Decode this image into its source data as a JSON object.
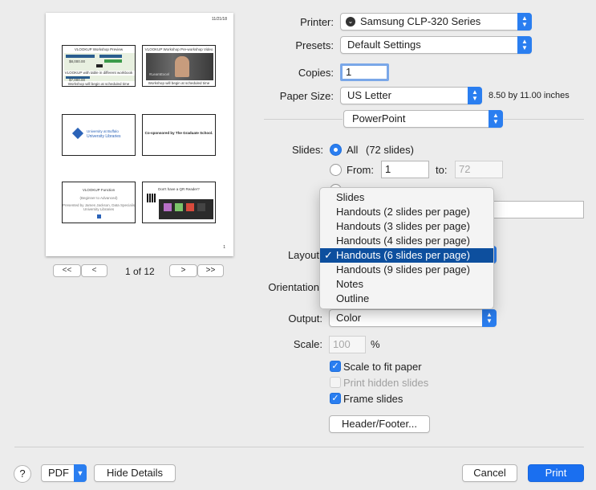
{
  "preview": {
    "date": "11/21/18",
    "page_number": "1",
    "nav_first": "<<",
    "nav_prev": "<",
    "nav_next": ">",
    "nav_last": ">>",
    "page_indicator": "1 of 12",
    "slides": {
      "s1_title": "VLOOKUP Workshop Preview",
      "s1_cap1": "VLOOKUP with table in different workbook",
      "s1_cap2": "Workshop will begin at scheduled time",
      "s1_val1": "$8,000.00",
      "s1_val2": "$7,000.00",
      "s2_title": "VLOOKUP Workshop Pre-workshop Video",
      "s2_cap": "Workshop will begin at scheduled time",
      "s2_overlay": "#LearnExcel",
      "s3_line1": "University at Buffalo",
      "s3_line2": "University Libraries",
      "s4_text": "Co-sponsored by The Graduate School.",
      "s5_title": "VLOOKUP Function",
      "s5_sub": "(Beginner to Advanced)",
      "s5_line": "Presented by James Jackson, Data Specialist",
      "s5_line2": "University Libraries",
      "s6_title": "Don't have a QR Reader?"
    }
  },
  "printer": {
    "label": "Printer:",
    "value": "Samsung CLP-320 Series"
  },
  "presets": {
    "label": "Presets:",
    "value": "Default Settings"
  },
  "copies": {
    "label": "Copies:",
    "value": "1"
  },
  "paper_size": {
    "label": "Paper Size:",
    "value": "US Letter",
    "dimensions": "8.50 by 11.00 inches"
  },
  "app_section": {
    "value": "PowerPoint"
  },
  "slides": {
    "label": "Slides:",
    "all_label": "All",
    "all_count": "(72 slides)",
    "from_label": "From:",
    "from_value": "1",
    "to_label": "to:",
    "to_value": "72"
  },
  "layout": {
    "label": "Layout",
    "menu_items": [
      "Slides",
      "Handouts (2 slides per page)",
      "Handouts (3 slides per page)",
      "Handouts (4 slides per page)",
      "Handouts (6 slides per page)",
      "Handouts (9 slides per page)",
      "Notes",
      "Outline"
    ],
    "checkmark": "✓"
  },
  "orientation": {
    "label": "Orientation"
  },
  "output": {
    "label": "Output:",
    "value": "Color"
  },
  "scale": {
    "label": "Scale:",
    "value": "100",
    "unit": "%"
  },
  "options": {
    "scale_to_fit": "Scale to fit paper",
    "print_hidden": "Print hidden slides",
    "frame_slides": "Frame slides"
  },
  "header_footer_button": "Header/Footer...",
  "footer": {
    "help": "?",
    "pdf": "PDF",
    "hide_details": "Hide Details",
    "cancel": "Cancel",
    "print": "Print"
  },
  "colors": {
    "accent": "#2a7ef0",
    "menu_selected": "#0d4f9e"
  }
}
